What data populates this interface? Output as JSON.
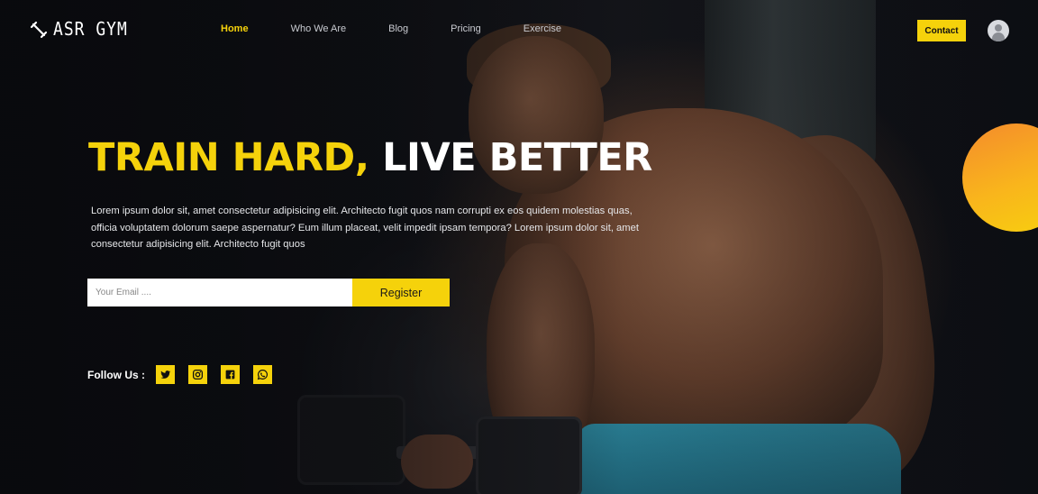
{
  "brand": {
    "logo_text": "ASR GYM",
    "accent": "#f5d20b"
  },
  "nav": {
    "links": [
      {
        "label": "Home",
        "active": true
      },
      {
        "label": "Who We Are"
      },
      {
        "label": "Blog"
      },
      {
        "label": "Pricing"
      },
      {
        "label": "Exercise"
      }
    ],
    "contact_label": "Contact"
  },
  "hero": {
    "headline_accent": "TRAIN HARD,",
    "headline_rest": " LIVE BETTER",
    "description": "Lorem ipsum dolor sit, amet consectetur adipisicing elit. Architecto fugit quos nam corrupti ex eos quidem molestias quas, officia voluptatem dolorum saepe aspernatur? Eum illum placeat, velit impedit ipsam tempora? Lorem ipsum dolor sit, amet consectetur adipisicing elit. Architecto fugit quos"
  },
  "form": {
    "email_placeholder": "Your Email ....",
    "email_value": "",
    "register_label": "Register"
  },
  "social": {
    "label": "Follow Us :",
    "icons": [
      "twitter-icon",
      "instagram-icon",
      "facebook-icon",
      "whatsapp-icon"
    ]
  }
}
